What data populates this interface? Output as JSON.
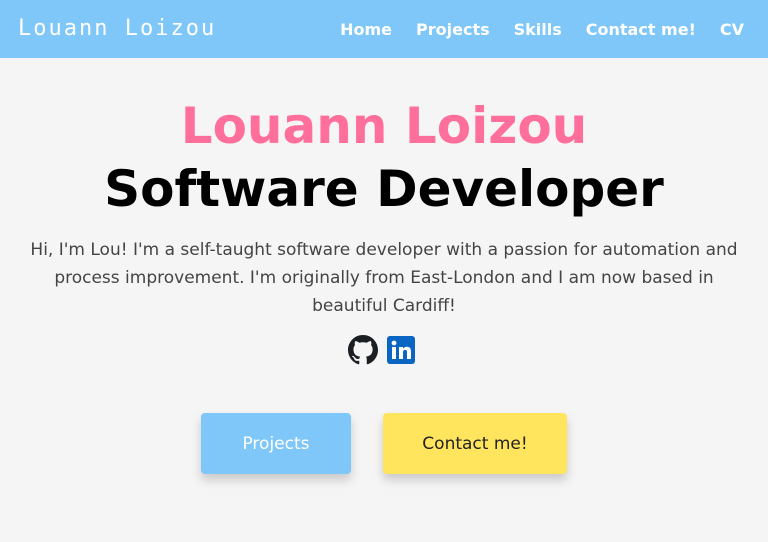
{
  "nav": {
    "logo": "Louann Loizou",
    "links": [
      "Home",
      "Projects",
      "Skills",
      "Contact me!",
      "CV"
    ]
  },
  "hero": {
    "name": "Louann Loizou",
    "role": "Software Developer",
    "intro": "Hi, I'm Lou! I'm a self-taught software developer with a passion for automation and process improvement. I'm originally from East-London and I am now based in beautiful Cardiff!"
  },
  "socials": [
    {
      "icon": "github-icon"
    },
    {
      "icon": "linkedin-icon"
    }
  ],
  "buttons": {
    "projects": "Projects",
    "contact": "Contact me!"
  },
  "colors": {
    "navbar": "#7fc7f8",
    "name": "#ff6f9c",
    "projects_button": "#7fc7f8",
    "contact_button": "#ffe45e"
  }
}
